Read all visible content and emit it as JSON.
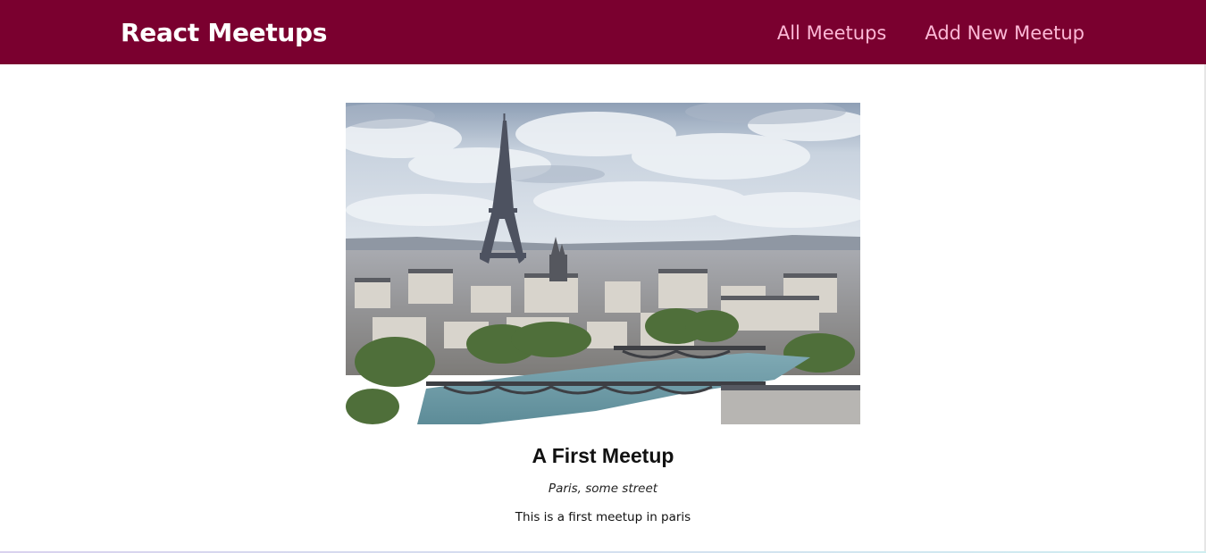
{
  "header": {
    "logo": "React Meetups",
    "nav": [
      {
        "label": "All Meetups"
      },
      {
        "label": "Add New Meetup"
      }
    ]
  },
  "meetups": [
    {
      "title": "A First Meetup",
      "address": "Paris, some street",
      "description": "This is a first meetup in paris"
    }
  ],
  "colors": {
    "header_bg": "#7a002f",
    "logo_text": "#ffffff",
    "nav_link": "#fcb8d6"
  }
}
